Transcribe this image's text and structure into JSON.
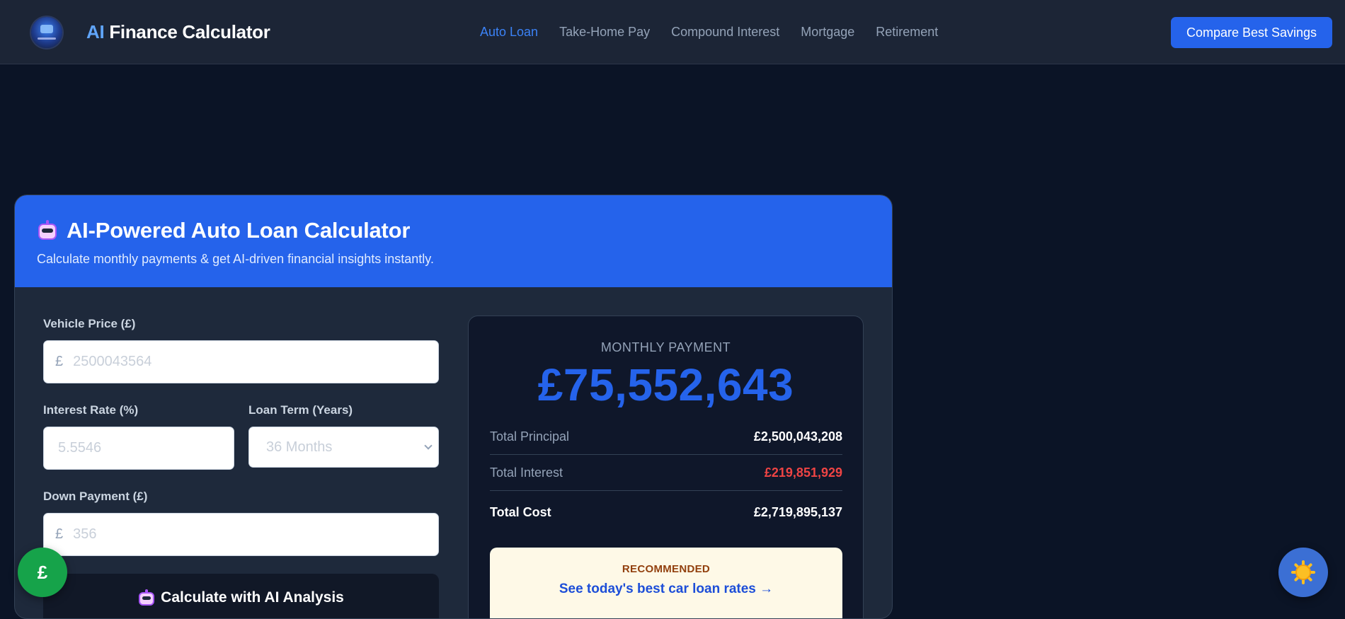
{
  "header": {
    "brand_ai": "AI",
    "brand_rest": "Finance Calculator",
    "nav": [
      {
        "label": "Auto Loan",
        "active": true
      },
      {
        "label": "Take-Home Pay",
        "active": false
      },
      {
        "label": "Compound Interest",
        "active": false
      },
      {
        "label": "Mortgage",
        "active": false
      },
      {
        "label": "Retirement",
        "active": false
      }
    ],
    "cta_label": "Compare Best Savings"
  },
  "calculator": {
    "title": "AI-Powered Auto Loan Calculator",
    "subtitle": "Calculate monthly payments & get AI-driven financial insights instantly.",
    "vehicle_price": {
      "label": "Vehicle Price (£)",
      "currency": "£",
      "placeholder": "2500043564",
      "value": ""
    },
    "interest_rate": {
      "label": "Interest Rate (%)",
      "placeholder": "5.5546",
      "value": ""
    },
    "loan_term": {
      "label": "Loan Term (Years)",
      "selected": "36 Months"
    },
    "down_payment": {
      "label": "Down Payment (£)",
      "currency": "£",
      "placeholder": "356",
      "value": ""
    },
    "calculate_label": "Calculate with AI Analysis"
  },
  "results": {
    "monthly_label": "MONTHLY PAYMENT",
    "monthly_value": "£75,552,643",
    "rows": [
      {
        "label": "Total Principal",
        "value": "£2,500,043,208"
      },
      {
        "label": "Total Interest",
        "value": "£219,851,929"
      },
      {
        "label": "Total Cost",
        "value": "£2,719,895,137"
      }
    ],
    "recommended_tag": "RECOMMENDED",
    "recommended_link": "See today's best car loan rates →"
  },
  "fab": {
    "currency_symbol": "£",
    "theme_icon": "sun-icon"
  },
  "colors": {
    "accent": "#2563eb",
    "page_bg": "#0b1426",
    "header_bg": "#1c2536",
    "negative": "#ef4444",
    "fab_green": "#16a34a"
  }
}
